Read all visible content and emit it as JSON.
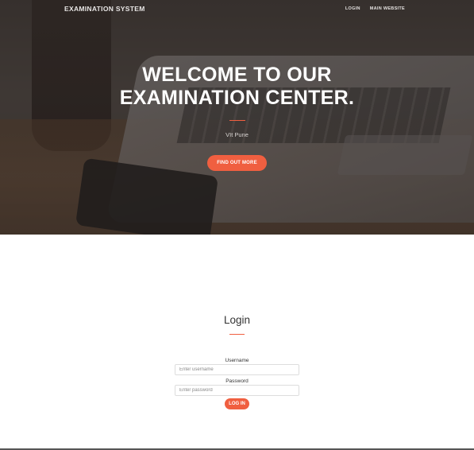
{
  "nav": {
    "brand": "EXAMINATION SYSTEM",
    "links": [
      {
        "label": "LOGIN"
      },
      {
        "label": "MAIN WEBSITE"
      }
    ]
  },
  "hero": {
    "title_line1": "WELCOME TO OUR",
    "title_line2": "EXAMINATION CENTER.",
    "subtitle": "VIt Pune",
    "button_label": "FIND OUT MORE"
  },
  "login": {
    "title": "Login",
    "username_label": "Username",
    "username_placeholder": "Enter username",
    "username_value": "",
    "password_label": "Password",
    "password_placeholder": "Enter password",
    "password_value": "",
    "submit_label": "LOG IN"
  },
  "colors": {
    "accent": "#f05f40",
    "hero_overlay": "#3e3835",
    "text": "#333333"
  }
}
